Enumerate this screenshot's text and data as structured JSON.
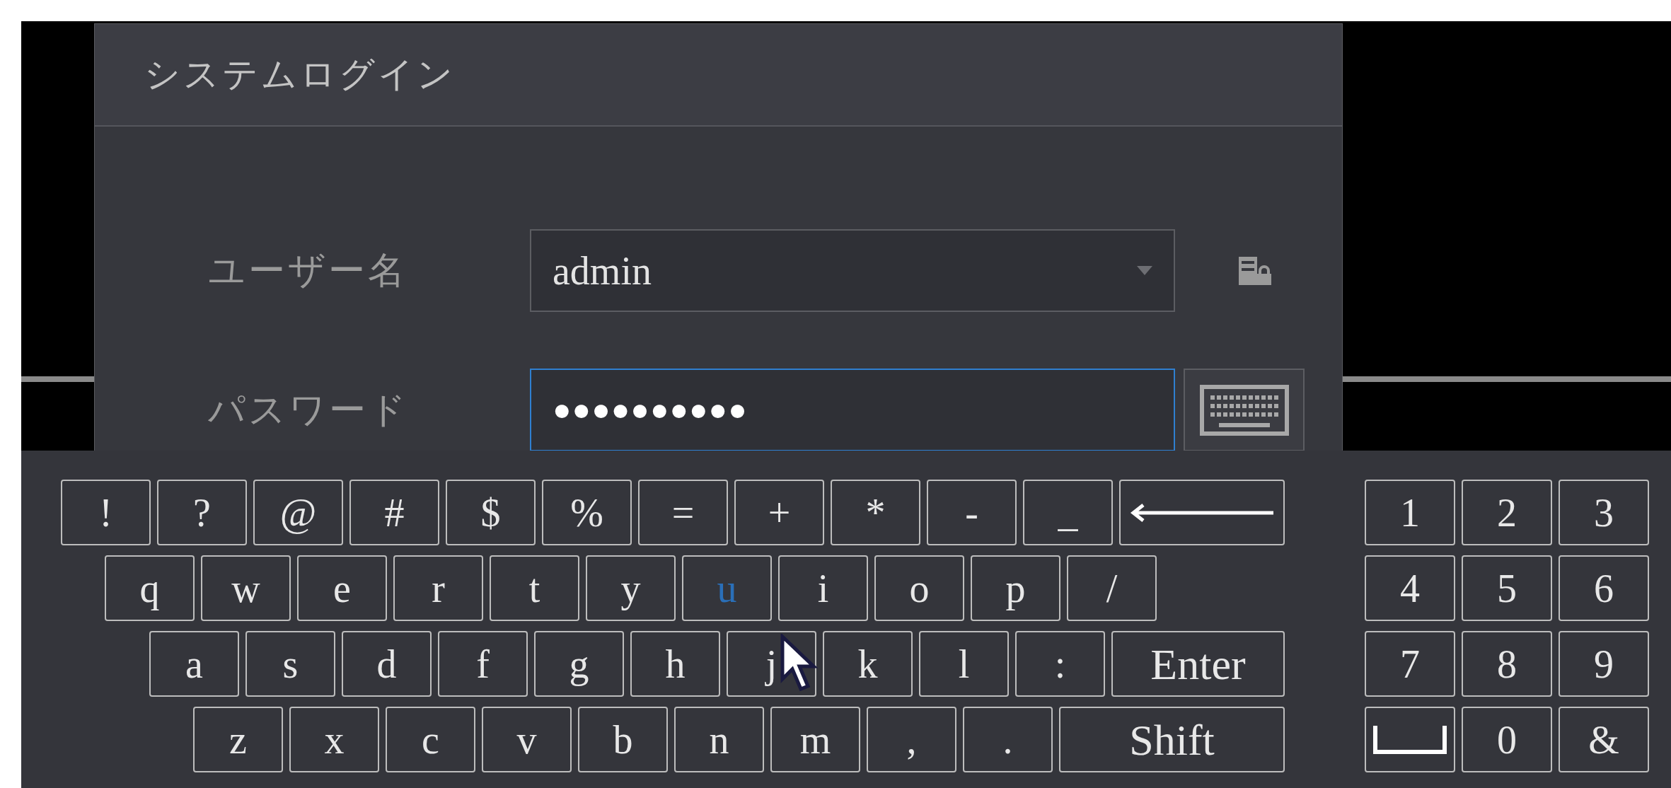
{
  "dialog": {
    "title": "システムログイン",
    "fields": [
      {
        "kind": "dropdown",
        "label": "ユーザー名",
        "value": "admin",
        "focused": false
      },
      {
        "kind": "password",
        "label": "パスワード",
        "value": "●●●●●●●●●●",
        "focused": true
      }
    ]
  },
  "keyboard": {
    "rows": [
      [
        {
          "kind": "char",
          "label": "!",
          "selected": false
        },
        {
          "kind": "char",
          "label": "?",
          "selected": false
        },
        {
          "kind": "char",
          "label": "@",
          "selected": false
        },
        {
          "kind": "char",
          "label": "#",
          "selected": false
        },
        {
          "kind": "char",
          "label": "$",
          "selected": false
        },
        {
          "kind": "char",
          "label": "%",
          "selected": false
        },
        {
          "kind": "char",
          "label": "=",
          "selected": false
        },
        {
          "kind": "char",
          "label": "+",
          "selected": false
        },
        {
          "kind": "char",
          "label": "*",
          "selected": false
        },
        {
          "kind": "char",
          "label": "-",
          "selected": false
        },
        {
          "kind": "char",
          "label": "_",
          "selected": false
        },
        {
          "kind": "backspace",
          "selected": false
        }
      ],
      [
        {
          "kind": "char",
          "label": "q",
          "selected": false
        },
        {
          "kind": "char",
          "label": "w",
          "selected": false
        },
        {
          "kind": "char",
          "label": "e",
          "selected": false
        },
        {
          "kind": "char",
          "label": "r",
          "selected": false
        },
        {
          "kind": "char",
          "label": "t",
          "selected": false
        },
        {
          "kind": "char",
          "label": "y",
          "selected": false
        },
        {
          "kind": "char",
          "label": "u",
          "selected": true
        },
        {
          "kind": "char",
          "label": "i",
          "selected": false
        },
        {
          "kind": "char",
          "label": "o",
          "selected": false
        },
        {
          "kind": "char",
          "label": "p",
          "selected": false
        },
        {
          "kind": "char",
          "label": "/",
          "selected": false
        }
      ],
      [
        {
          "kind": "char",
          "label": "a",
          "selected": false
        },
        {
          "kind": "char",
          "label": "s",
          "selected": false
        },
        {
          "kind": "char",
          "label": "d",
          "selected": false
        },
        {
          "kind": "char",
          "label": "f",
          "selected": false
        },
        {
          "kind": "char",
          "label": "g",
          "selected": false
        },
        {
          "kind": "char",
          "label": "h",
          "selected": false
        },
        {
          "kind": "char",
          "label": "j",
          "selected": false
        },
        {
          "kind": "char",
          "label": "k",
          "selected": false
        },
        {
          "kind": "char",
          "label": "l",
          "selected": false
        },
        {
          "kind": "char",
          "label": ":",
          "selected": false
        },
        {
          "kind": "wide",
          "label": "Enter",
          "selected": false
        }
      ],
      [
        {
          "kind": "char",
          "label": "z",
          "selected": false
        },
        {
          "kind": "char",
          "label": "x",
          "selected": false
        },
        {
          "kind": "char",
          "label": "c",
          "selected": false
        },
        {
          "kind": "char",
          "label": "v",
          "selected": false
        },
        {
          "kind": "char",
          "label": "b",
          "selected": false
        },
        {
          "kind": "char",
          "label": "n",
          "selected": false
        },
        {
          "kind": "char",
          "label": "m",
          "selected": false
        },
        {
          "kind": "char",
          "label": ",",
          "selected": false
        },
        {
          "kind": "char",
          "label": ".",
          "selected": false
        },
        {
          "kind": "wide",
          "label": "Shift",
          "selected": false
        }
      ]
    ],
    "numpad": [
      [
        {
          "kind": "char",
          "label": "1",
          "selected": false
        },
        {
          "kind": "char",
          "label": "2",
          "selected": false
        },
        {
          "kind": "char",
          "label": "3",
          "selected": false
        }
      ],
      [
        {
          "kind": "char",
          "label": "4",
          "selected": false
        },
        {
          "kind": "char",
          "label": "5",
          "selected": false
        },
        {
          "kind": "char",
          "label": "6",
          "selected": false
        }
      ],
      [
        {
          "kind": "char",
          "label": "7",
          "selected": false
        },
        {
          "kind": "char",
          "label": "8",
          "selected": false
        },
        {
          "kind": "char",
          "label": "9",
          "selected": false
        }
      ],
      [
        {
          "kind": "space",
          "selected": false
        },
        {
          "kind": "char",
          "label": "0",
          "selected": false
        },
        {
          "kind": "char",
          "label": "&",
          "selected": false
        }
      ]
    ]
  }
}
